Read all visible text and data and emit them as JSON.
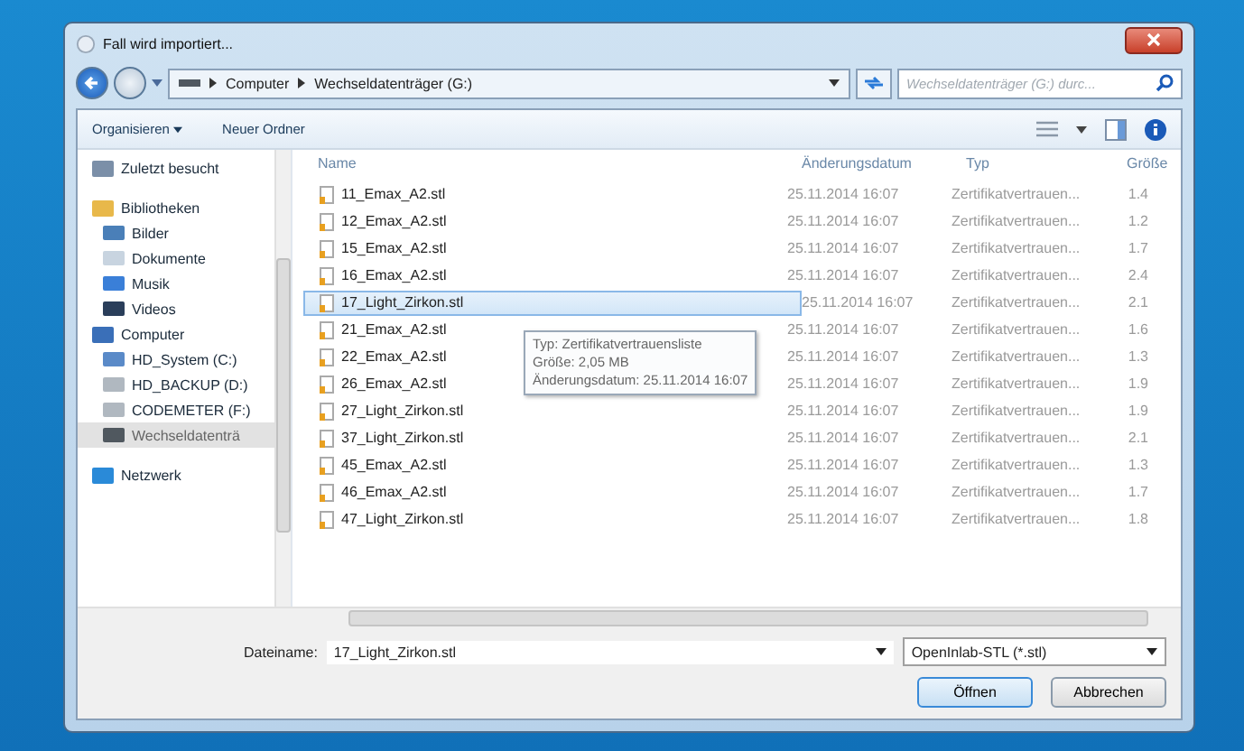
{
  "window": {
    "title": "Fall wird importiert..."
  },
  "address": {
    "path": [
      "Computer",
      "Wechseldatenträger (G:)"
    ]
  },
  "search": {
    "placeholder": "Wechseldatenträger (G:) durc..."
  },
  "toolbar": {
    "organize": "Organisieren",
    "new_folder": "Neuer Ordner"
  },
  "sidebar": {
    "items": [
      {
        "label": "Zuletzt besucht",
        "selected": false
      },
      {
        "label": "Bibliotheken",
        "selected": false,
        "children": [
          {
            "label": "Bilder",
            "selected": false
          },
          {
            "label": "Dokumente",
            "selected": false
          },
          {
            "label": "Musik",
            "selected": false
          },
          {
            "label": "Videos",
            "selected": false
          }
        ]
      },
      {
        "label": "Computer",
        "selected": false,
        "children": [
          {
            "label": "HD_System (C:)",
            "selected": false
          },
          {
            "label": "HD_BACKUP (D:)",
            "selected": false
          },
          {
            "label": "CODEMETER (F:)",
            "selected": false
          },
          {
            "label": "Wechseldatenträ",
            "selected": true
          }
        ]
      },
      {
        "label": "Netzwerk",
        "selected": false
      }
    ]
  },
  "table": {
    "columns": [
      "Name",
      "Änderungsdatum",
      "Typ",
      "Größe"
    ],
    "rows": [
      {
        "name": "11_Emax_A2.stl",
        "date": "25.11.2014 16:07",
        "type": "Zertifikatvertrauen...",
        "size": "1.4",
        "selected": false
      },
      {
        "name": "12_Emax_A2.stl",
        "date": "25.11.2014 16:07",
        "type": "Zertifikatvertrauen...",
        "size": "1.2",
        "selected": false
      },
      {
        "name": "15_Emax_A2.stl",
        "date": "25.11.2014 16:07",
        "type": "Zertifikatvertrauen...",
        "size": "1.7",
        "selected": false
      },
      {
        "name": "16_Emax_A2.stl",
        "date": "25.11.2014 16:07",
        "type": "Zertifikatvertrauen...",
        "size": "2.4",
        "selected": false
      },
      {
        "name": "17_Light_Zirkon.stl",
        "date": "25.11.2014 16:07",
        "type": "Zertifikatvertrauen...",
        "size": "2.1",
        "selected": true
      },
      {
        "name": "21_Emax_A2.stl",
        "date": "25.11.2014 16:07",
        "type": "Zertifikatvertrauen...",
        "size": "1.6",
        "selected": false
      },
      {
        "name": "22_Emax_A2.stl",
        "date": "25.11.2014 16:07",
        "type": "Zertifikatvertrauen...",
        "size": "1.3",
        "selected": false
      },
      {
        "name": "26_Emax_A2.stl",
        "date": "25.11.2014 16:07",
        "type": "Zertifikatvertrauen...",
        "size": "1.9",
        "selected": false
      },
      {
        "name": "27_Light_Zirkon.stl",
        "date": "25.11.2014 16:07",
        "type": "Zertifikatvertrauen...",
        "size": "1.9",
        "selected": false
      },
      {
        "name": "37_Light_Zirkon.stl",
        "date": "25.11.2014 16:07",
        "type": "Zertifikatvertrauen...",
        "size": "2.1",
        "selected": false
      },
      {
        "name": "45_Emax_A2.stl",
        "date": "25.11.2014 16:07",
        "type": "Zertifikatvertrauen...",
        "size": "1.3",
        "selected": false
      },
      {
        "name": "46_Emax_A2.stl",
        "date": "25.11.2014 16:07",
        "type": "Zertifikatvertrauen...",
        "size": "1.7",
        "selected": false
      },
      {
        "name": "47_Light_Zirkon.stl",
        "date": "25.11.2014 16:07",
        "type": "Zertifikatvertrauen...",
        "size": "1.8",
        "selected": false
      }
    ]
  },
  "tooltip": {
    "lines": [
      "Typ: Zertifikatvertrauensliste",
      "Größe: 2,05 MB",
      "Änderungsdatum: 25.11.2014 16:07"
    ]
  },
  "footer": {
    "filename_label": "Dateiname:",
    "filename": "17_Light_Zirkon.stl",
    "filetype": "OpenInlab-STL (*.stl)",
    "buttons": [
      "Öffnen",
      "Abbrechen"
    ]
  }
}
